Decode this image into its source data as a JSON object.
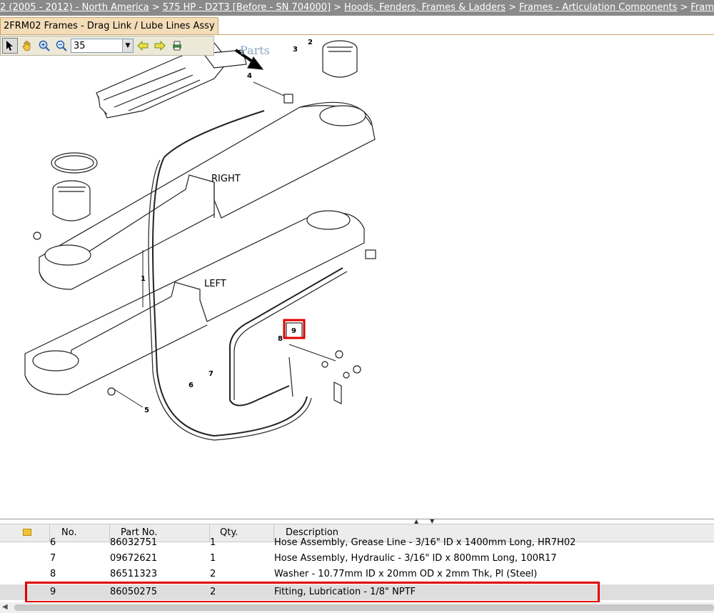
{
  "breadcrumb": {
    "items": [
      "2 (2005 - 2012) - North America",
      "575 HP - D2T3 [Before - SN 704000]",
      "Hoods, Fenders, Frames & Ladders",
      "Frames - Articulation Components",
      "Frames -"
    ],
    "separator": ">"
  },
  "window": {
    "title": "2FRM02 Frames - Drag Link / Lube Lines Assy"
  },
  "toolbar": {
    "zoom_value": "35",
    "tools": [
      "pointer-icon",
      "hand-icon",
      "zoom-in-icon",
      "zoom-out-icon",
      "back-arrow-icon",
      "forward-arrow-icon",
      "print-icon"
    ]
  },
  "drawing": {
    "watermark": "Parts",
    "labels": {
      "right": "RIGHT",
      "left": "LEFT"
    },
    "callouts": [
      "1",
      "2",
      "3",
      "4",
      "5",
      "6",
      "7",
      "8",
      "9"
    ],
    "highlighted_callout": "9",
    "highlight_color": "#e00000"
  },
  "table": {
    "columns": [
      "No.",
      "Part No.",
      "Qty.",
      "Description"
    ],
    "rows": [
      {
        "no": "6",
        "part": "86032751",
        "qty": "1",
        "desc": "Hose Assembly, Grease Line - 3/16\" ID x 1400mm Long, HR7H02"
      },
      {
        "no": "7",
        "part": "09672621",
        "qty": "1",
        "desc": "Hose Assembly, Hydraulic - 3/16\" ID x 800mm Long, 100R17"
      },
      {
        "no": "8",
        "part": "86511323",
        "qty": "2",
        "desc": "Washer - 10.77mm ID x 20mm OD x 2mm Thk, Pl (Steel)"
      },
      {
        "no": "9",
        "part": "86050275",
        "qty": "2",
        "desc": "Fitting, Lubrication - 1/8\" NPTF"
      }
    ],
    "selected_row": "9"
  }
}
